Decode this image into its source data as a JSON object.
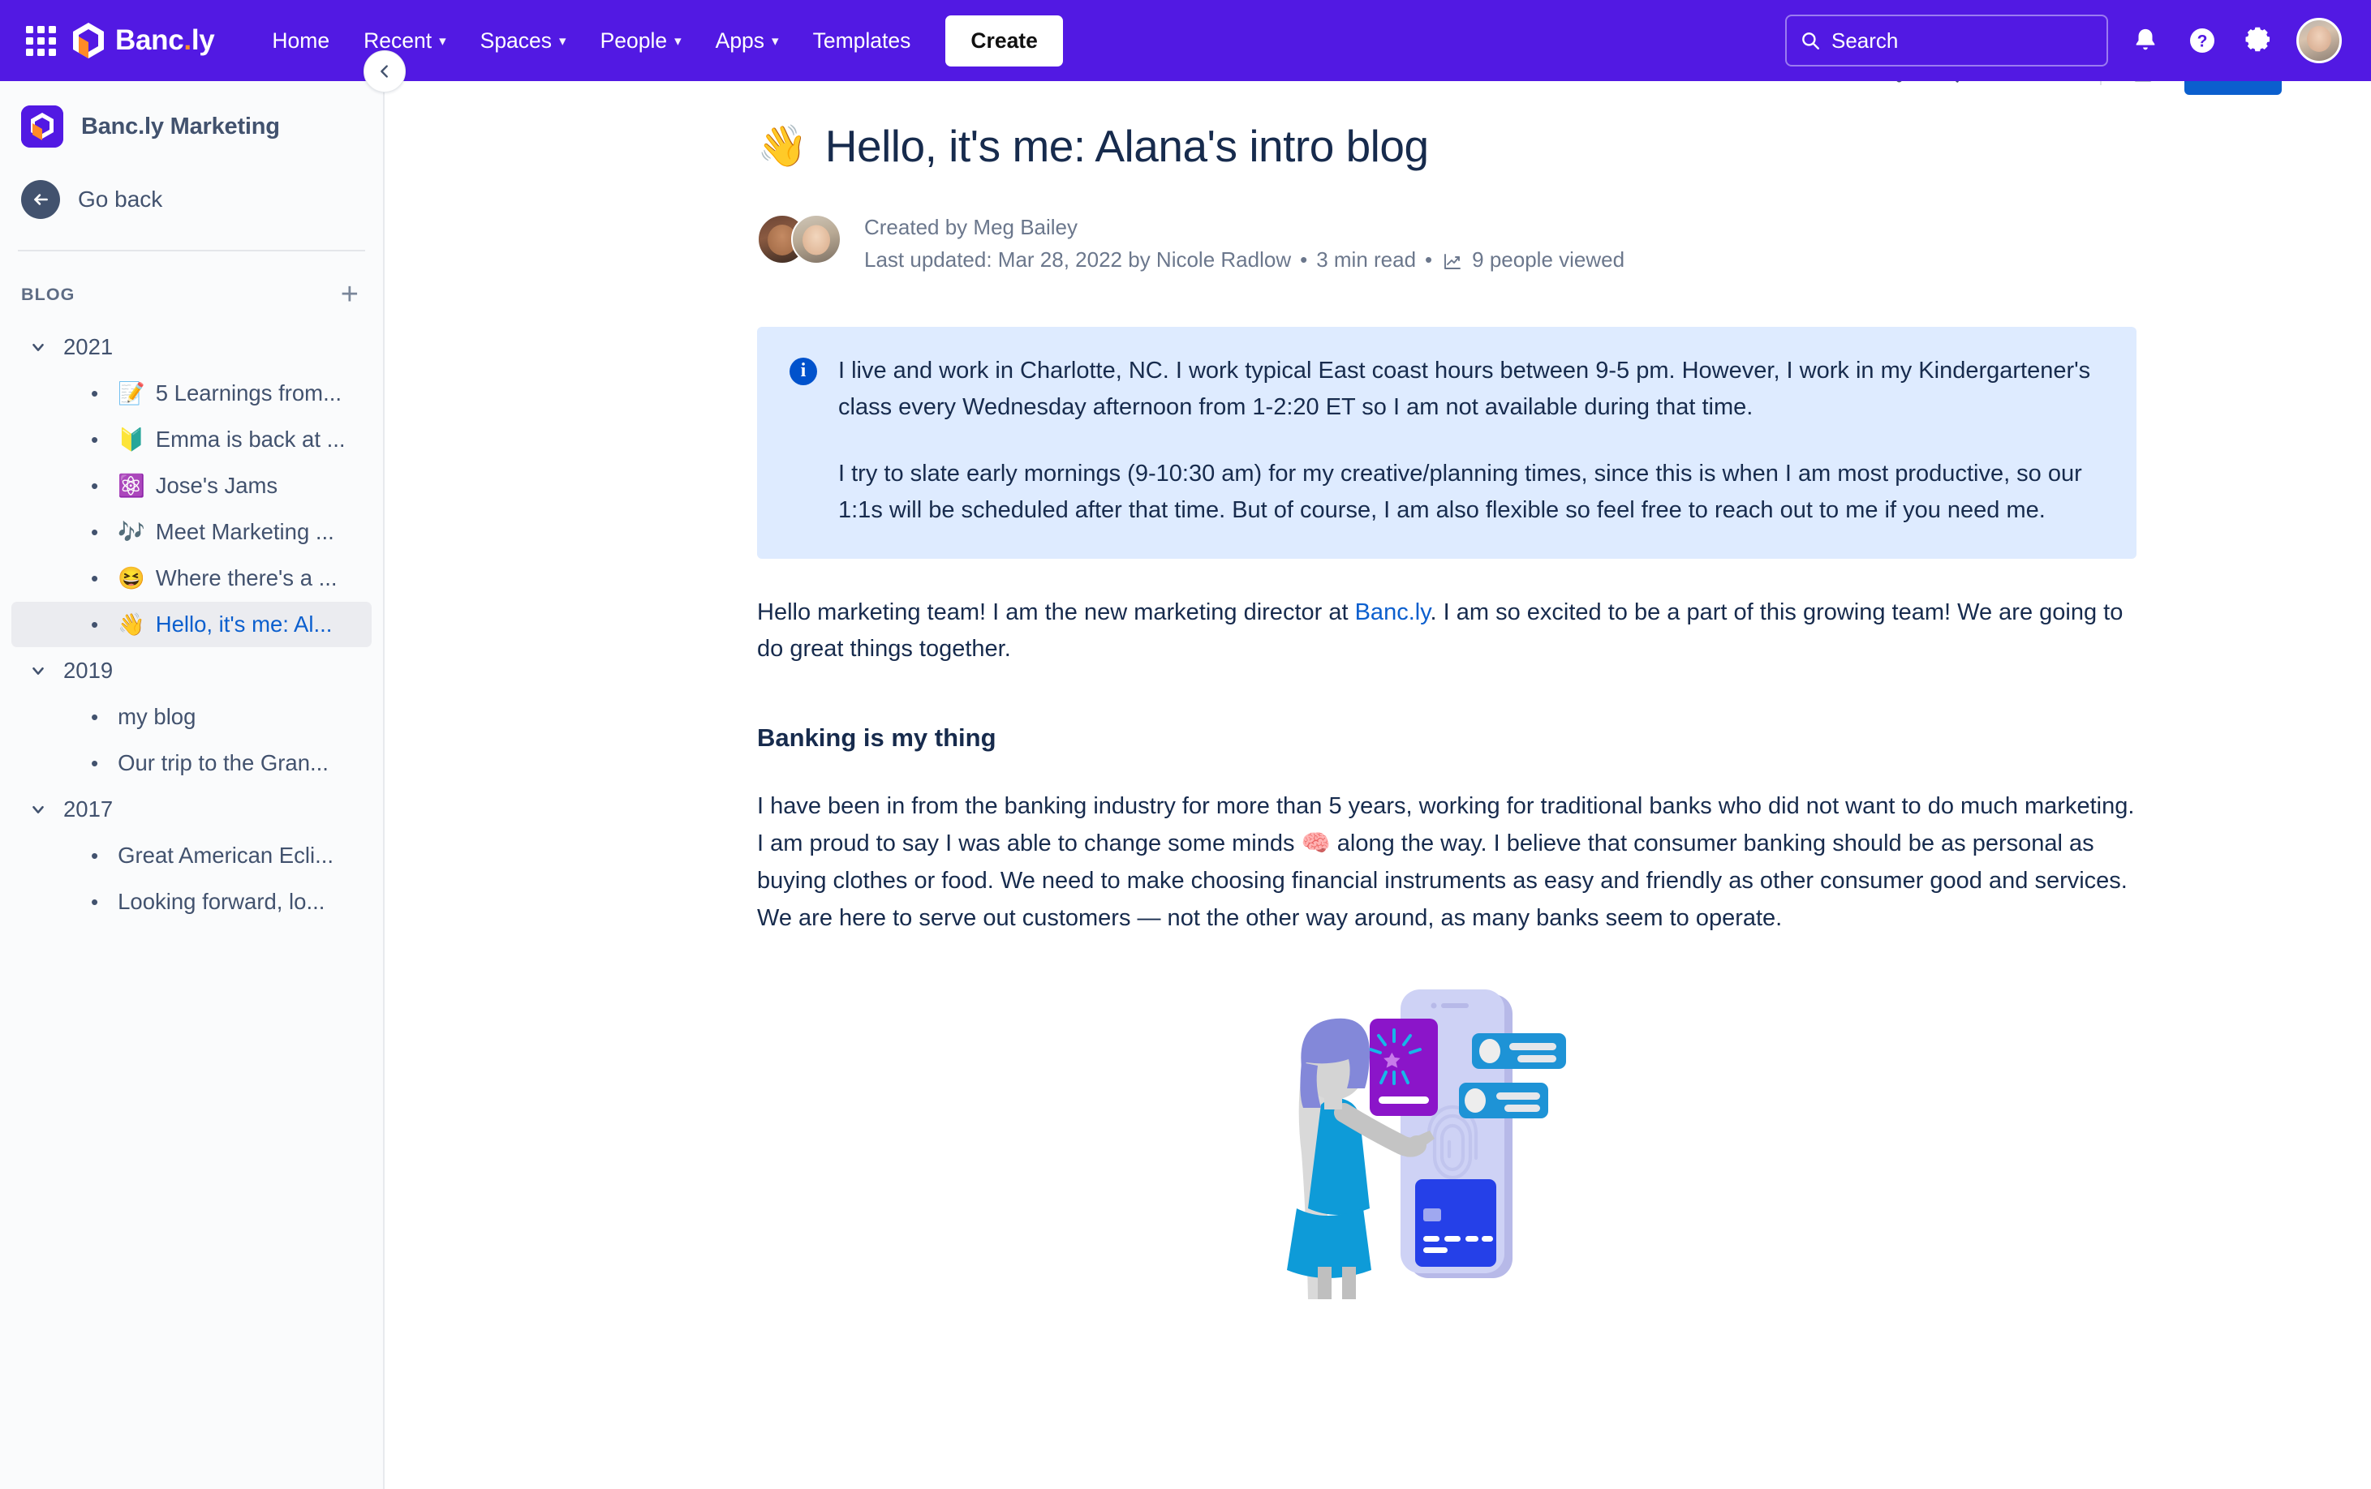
{
  "nav": {
    "app_switcher_icon": "grid-apps-icon",
    "brand": {
      "name_main": "Banc",
      "name_dot": ".",
      "name_suffix": "ly"
    },
    "links": [
      {
        "label": "Home",
        "has_chevron": false
      },
      {
        "label": "Recent",
        "has_chevron": true
      },
      {
        "label": "Spaces",
        "has_chevron": true
      },
      {
        "label": "People",
        "has_chevron": true
      },
      {
        "label": "Apps",
        "has_chevron": true
      },
      {
        "label": "Templates",
        "has_chevron": false
      }
    ],
    "create_label": "Create",
    "search_placeholder": "Search",
    "icons": [
      "notification-bell-icon",
      "help-question-icon",
      "settings-gear-icon",
      "user-avatar"
    ],
    "accent_color": "#5219E3"
  },
  "subtoolbar": {
    "breadcrumb_hint": "",
    "icons": [
      "share-icon",
      "search-page-icon",
      "star-icon",
      "more-icon",
      "sidebar-icon"
    ],
    "primary_button_color": "#0B5FCE"
  },
  "sidebar": {
    "space_title": "Banc.ly Marketing",
    "go_back_label": "Go back",
    "section_label": "BLOG",
    "add_label": "+",
    "collapse_icon": "chevron-left-icon",
    "tree": [
      {
        "year": "2021",
        "expanded": true,
        "items": [
          {
            "emoji": "📝",
            "label": "5 Learnings from...",
            "selected": false
          },
          {
            "emoji": "🔰",
            "label": "Emma is back at ...",
            "selected": false
          },
          {
            "emoji": "⚛️",
            "label": "Jose's Jams",
            "selected": false
          },
          {
            "emoji": "🎶",
            "label": "Meet Marketing ...",
            "selected": false
          },
          {
            "emoji": "😆",
            "label": "Where there's a ...",
            "selected": false
          },
          {
            "emoji": "👋",
            "label": "Hello, it's me: Al...",
            "selected": true
          }
        ]
      },
      {
        "year": "2019",
        "expanded": true,
        "items": [
          {
            "emoji": "",
            "label": "my blog",
            "selected": false
          },
          {
            "emoji": "",
            "label": "Our trip to the Gran...",
            "selected": false
          }
        ]
      },
      {
        "year": "2017",
        "expanded": true,
        "items": [
          {
            "emoji": "",
            "label": "Great American Ecli...",
            "selected": false
          },
          {
            "emoji": "",
            "label": "Looking forward, lo...",
            "selected": false
          }
        ]
      }
    ]
  },
  "document": {
    "title_emoji": "👋",
    "title": "Hello, it's me: Alana's intro blog",
    "created_by": "Created by Meg Bailey",
    "last_updated": "Last updated: Mar 28, 2022 by Nicole Radlow",
    "read_time": "3 min read",
    "views": "9 people viewed",
    "views_icon": "analytics-chart-icon",
    "info_panel": {
      "icon": "info-circle-icon",
      "background": "#DEEBFF",
      "paragraph1": "I live and work in Charlotte, NC. I work typical East coast hours between 9-5 pm. However, I work in my Kindergartener's class every Wednesday afternoon from 1-2:20 ET so I am not available during that time.",
      "paragraph2": "I try to slate early mornings (9-10:30 am) for my creative/planning times, since this is when I am most productive, so our 1:1s will be scheduled after that time. But of course, I am also flexible so feel free to reach out to me if you need me."
    },
    "intro_pre": "Hello marketing team! I am the new marketing director at ",
    "intro_link": "Banc.ly",
    "intro_post": ". I am so excited to be a part of this growing team! We are going to do great things together.",
    "section_heading": "Banking is my thing",
    "section_pre": "I have been in from the banking industry for more than 5 years, working for traditional banks who did not want to do much marketing. I am proud to say I was able to change some minds ",
    "section_emoji": "🧠",
    "section_post": " along the way. I believe that consumer banking should be as personal as buying clothes or food. We need to make choosing financial instruments as easy and friendly as other consumer good and services. We are here to serve out customers — not the other way around, as many banks seem to operate.",
    "illustration_name": "woman-with-phone-banking-illustration"
  }
}
